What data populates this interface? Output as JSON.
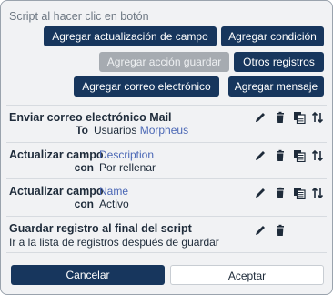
{
  "dialog": {
    "title": "Script al hacer clic en botón"
  },
  "buttons": {
    "add_field_update": "Agregar actualización de campo",
    "add_condition": "Agregar condición",
    "add_save_action": "Agregar acción guardar",
    "other_records": "Otros registros",
    "add_email": "Agregar correo electrónico",
    "add_message": "Agregar mensaje"
  },
  "steps": [
    {
      "title": "Enviar correo electrónico Mail",
      "label": "To",
      "value_plain": "Usuarios",
      "value_link": "Morpheus"
    },
    {
      "title": "Actualizar campo",
      "field_link": "Description",
      "label": "con",
      "value_plain": "Por rellenar"
    },
    {
      "title": "Actualizar campo",
      "field_link": "Name",
      "label": "con",
      "value_plain": "Activo"
    },
    {
      "title": "Guardar registro al final del script",
      "subtitle": "Ir a la lista de registros después de guardar"
    }
  ],
  "footer": {
    "cancel": "Cancelar",
    "accept": "Aceptar"
  },
  "icons": {
    "edit": "pencil-icon",
    "delete": "trash-icon",
    "copy": "copy-icon",
    "reorder": "reorder-arrows-icon"
  },
  "colors": {
    "primary": "#17365d",
    "disabled": "#a6abb1",
    "link": "#4a67b5",
    "background": "#f1f2f4"
  }
}
